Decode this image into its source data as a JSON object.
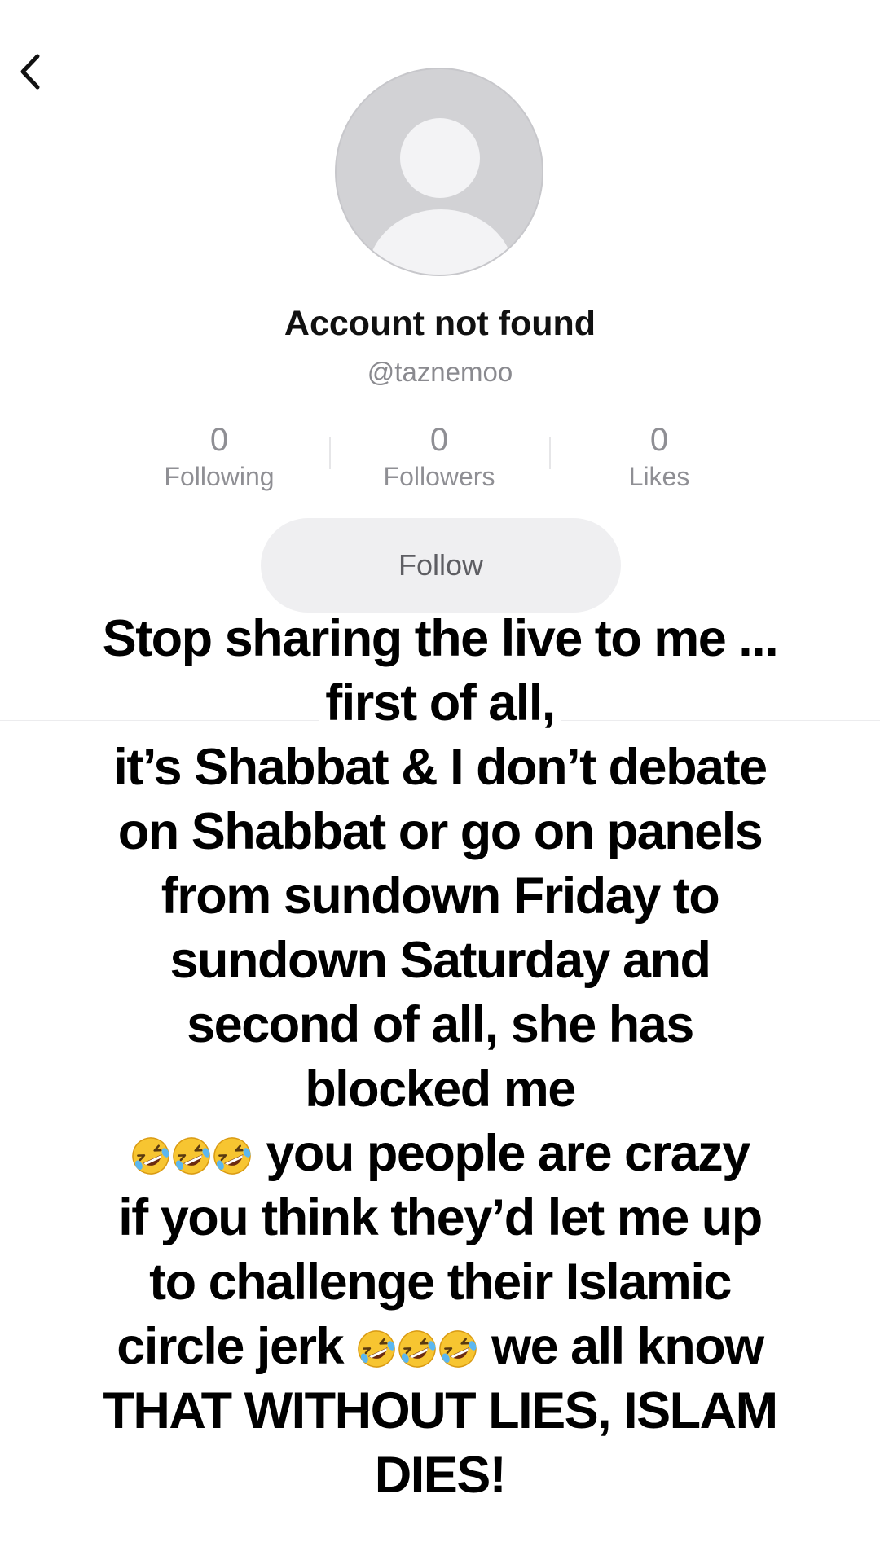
{
  "profile": {
    "name": "Account not found",
    "handle": "@taznemoo"
  },
  "stats": {
    "following": {
      "value": "0",
      "label": "Following"
    },
    "followers": {
      "value": "0",
      "label": "Followers"
    },
    "likes": {
      "value": "0",
      "label": "Likes"
    }
  },
  "follow_button": {
    "label": "Follow"
  },
  "icons": {
    "back": "chevron-left-icon",
    "avatar": "default-avatar-icon",
    "emoji": "rolling-on-the-floor-laughing"
  },
  "caption": {
    "line1": "Stop sharing the live to me ...",
    "line2": "first of all,",
    "line3": "it’s Shabbat & I don’t debate",
    "line4": "on Shabbat or go on panels",
    "line5": "from sundown Friday to",
    "line6": "sundown Saturday and",
    "line7": "second of all, she has",
    "line8": "blocked me",
    "line9": "you people are crazy",
    "line10": "if you think they’d let me up",
    "line11": "to challenge their Islamic",
    "line12a": "circle jerk",
    "line12b": "we all know",
    "line13": "THAT WITHOUT LIES, ISLAM",
    "line14": "DIES!"
  }
}
